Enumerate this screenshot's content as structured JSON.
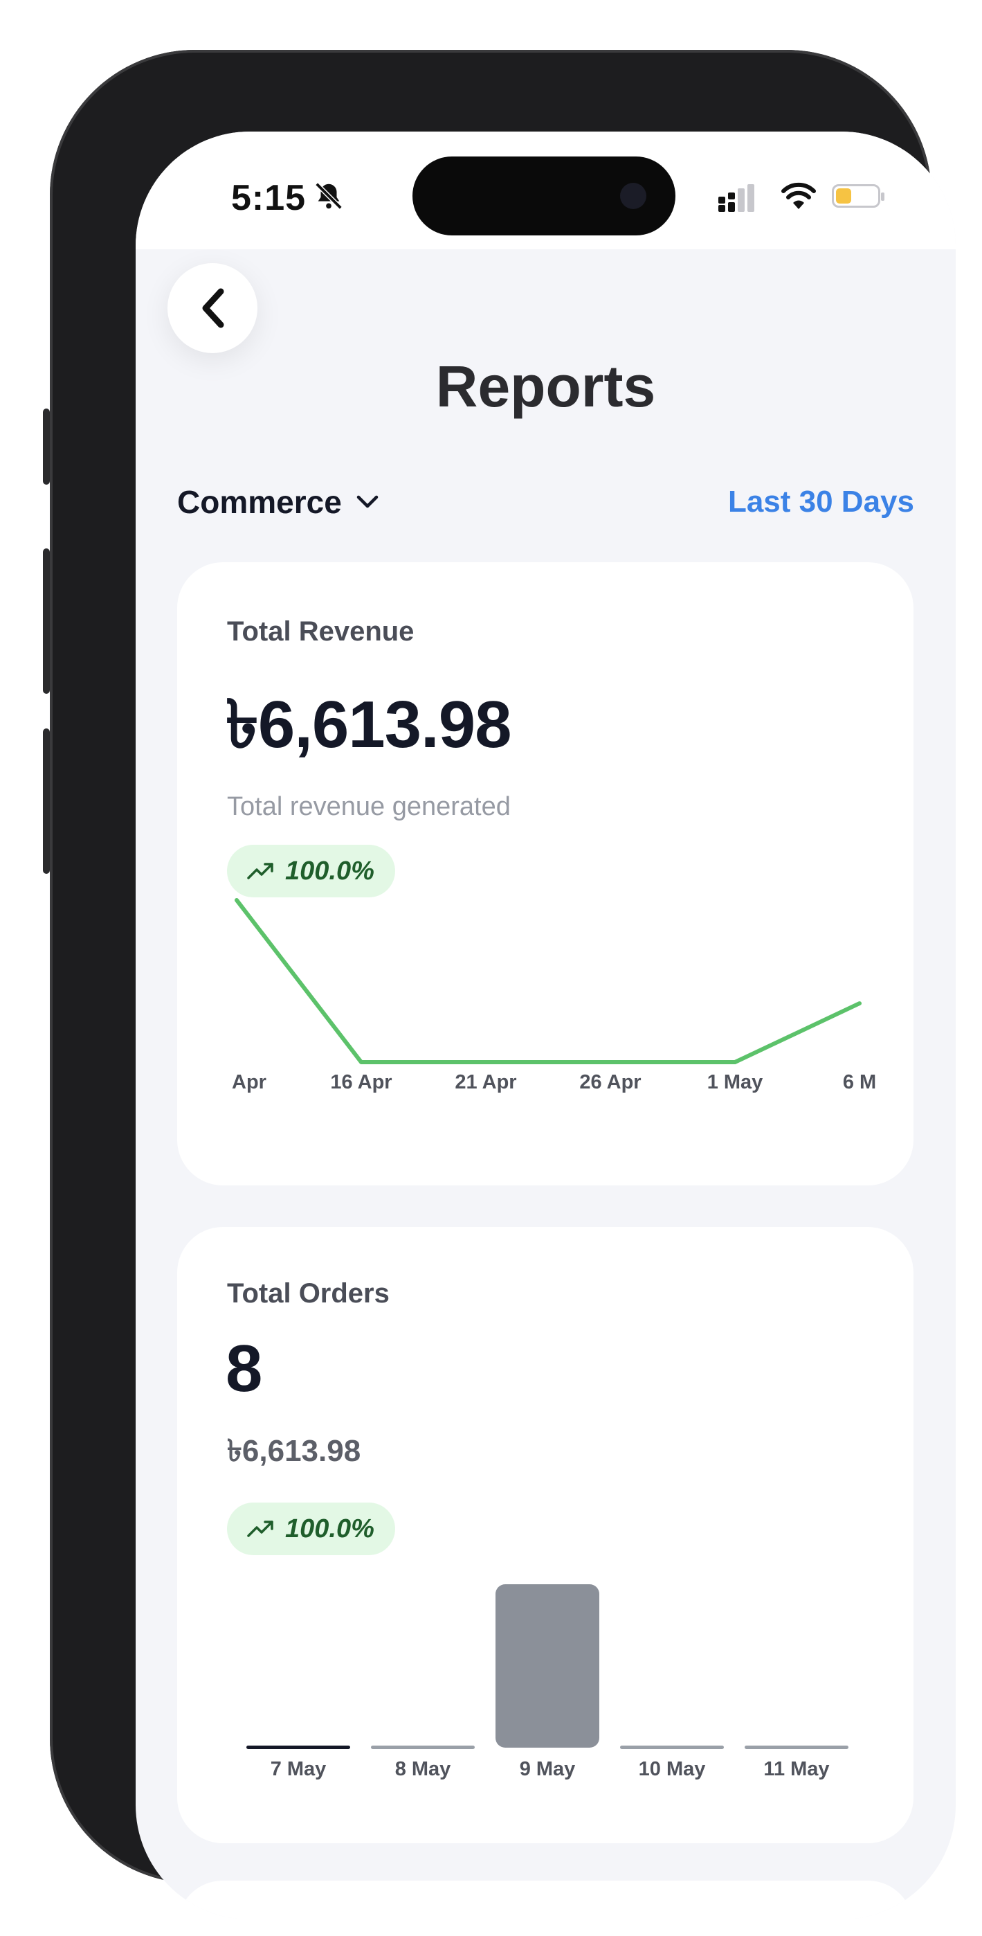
{
  "status_bar": {
    "time": "5:15"
  },
  "header": {
    "title": "Reports"
  },
  "filters": {
    "store": "Commerce",
    "date_range": "Last 30 Days"
  },
  "revenue_card": {
    "label": "Total Revenue",
    "value": "৳6,613.98",
    "subtitle": "Total revenue generated",
    "change": "100.0%"
  },
  "orders_card": {
    "label": "Total Orders",
    "value": "8",
    "amount": "৳6,613.98",
    "change": "100.0%"
  },
  "chart_data": [
    {
      "type": "line",
      "x": [
        "Apr",
        "16 Apr",
        "21 Apr",
        "26 Apr",
        "1 May",
        "6 M"
      ],
      "series": [
        {
          "values": [
            6613.98,
            0,
            0,
            0,
            0,
            2400
          ]
        }
      ],
      "color": "#5cc26a",
      "grid": false
    },
    {
      "type": "bar",
      "categories": [
        "7 May",
        "8 May",
        "9 May",
        "10 May",
        "11 May"
      ],
      "values": [
        0,
        0,
        8,
        0,
        0
      ],
      "highlight_color": "#8b9099",
      "grid": false
    }
  ]
}
